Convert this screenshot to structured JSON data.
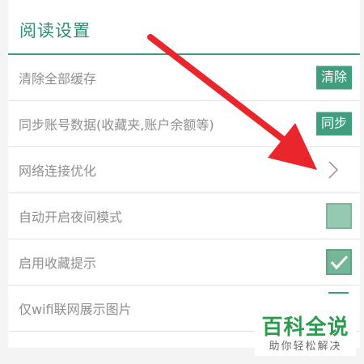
{
  "header": {
    "title": "阅读设置"
  },
  "settings": {
    "clear_cache": {
      "label": "清除全部缓存",
      "button": "清除"
    },
    "sync_account": {
      "label": "同步账号数据(收藏夹,账户余额等)",
      "button": "同步"
    },
    "network_optimize": {
      "label": "网络连接优化",
      "icon": "chevron-right-icon"
    },
    "night_mode": {
      "label": "自动开启夜间模式",
      "checked": false
    },
    "favorite_tip": {
      "label": "启用收藏提示",
      "checked": true
    },
    "wifi_images": {
      "label": "仅wifi联网展示图片"
    }
  },
  "watermark": {
    "title": "百科全说",
    "subtitle": "助你轻松解决"
  },
  "colors": {
    "accent": "#3f9e7e",
    "arrow": "#e8262b",
    "checkbox": "#95c9b2"
  }
}
